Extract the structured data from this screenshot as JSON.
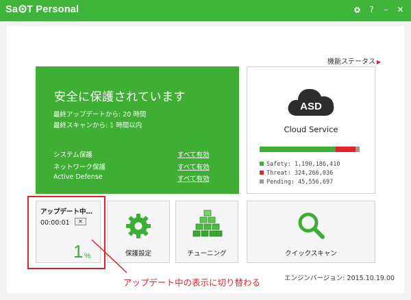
{
  "window": {
    "title_parts": [
      "Sa",
      "T Personal"
    ],
    "controls": {
      "settings_icon": "gear-icon",
      "help": "?",
      "minimize": "–",
      "close": "✕"
    }
  },
  "header": {
    "status_link": "機能ステータス"
  },
  "protection": {
    "title": "安全に保護されています",
    "last_update_label": "最終アップデートから:",
    "last_update_value": "20 時間",
    "last_scan_label": "最終スキャンから:",
    "last_scan_value": "1 時間以内",
    "items": [
      {
        "label": "システム保護",
        "value": "すべて有効"
      },
      {
        "label": "ネットワーク保護",
        "value": "すべて有効"
      },
      {
        "label": "Active Defense",
        "value": "すべて有効"
      }
    ]
  },
  "asd": {
    "badge": "ASD",
    "label": "Cloud Service",
    "bar_fractions": {
      "safety": 0.76,
      "threat": 0.2,
      "pending": 0.04
    },
    "legend": [
      {
        "text": "Safety: 1,190,186,410",
        "color": "#3eae35"
      },
      {
        "text": "Threat: 324,266,036",
        "color": "#e0262b"
      },
      {
        "text": "Pending: 45,556,697",
        "color": "#9a9a9a"
      }
    ]
  },
  "tiles": {
    "update": {
      "title": "アップデート中…",
      "elapsed": "00:00:01",
      "cancel": "✕",
      "progress_number": "1",
      "progress_unit": "%"
    },
    "protection_settings": "保護設定",
    "tuning": "チューニング",
    "quick_scan": "クイックスキャン"
  },
  "footer": {
    "engine_version": "エンジンバージョン: 2015.10.19.00"
  },
  "annotation": {
    "callout_text": "アップデート中の表示に切り替わる",
    "highlight_color": "#e21f26"
  },
  "colors": {
    "brand_green": "#3fb43b",
    "accent_red": "#e21f26"
  }
}
